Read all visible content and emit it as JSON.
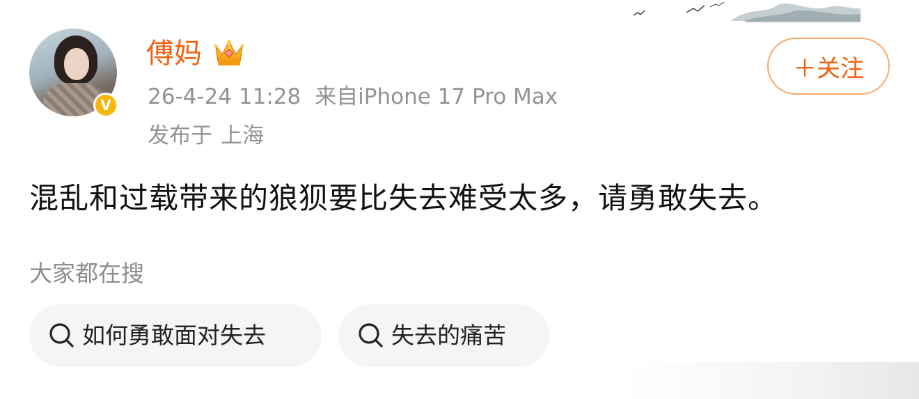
{
  "post": {
    "author": {
      "name": "傅妈",
      "verified_badge_label": "V",
      "avatar": "avatar-photo"
    },
    "follow_label": "＋关注",
    "timestamp": "26-4-24 11:28",
    "source": "来自iPhone 17 Pro Max",
    "location_prefix": "发布于",
    "location": "上海",
    "text": "混乱和过载带来的狼狈要比失去难受太多，请勇敢失去。"
  },
  "trending": {
    "title": "大家都在搜",
    "items": [
      {
        "label": "如何勇敢面对失去",
        "icon": "search-icon"
      },
      {
        "label": "失去的痛苦",
        "icon": "search-icon"
      }
    ]
  },
  "colors": {
    "brand_orange": "#f0620f",
    "follow_border": "#f6a96b",
    "meta_gray": "#939393",
    "verified_gold": "#f5b70a",
    "chip_bg": "#f5f5f5"
  }
}
